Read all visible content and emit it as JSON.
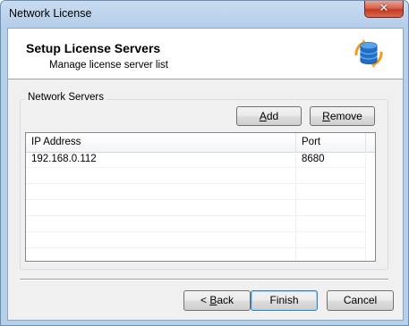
{
  "window": {
    "title": "Network License",
    "close_glyph": "✕"
  },
  "header": {
    "title": "Setup License Servers",
    "subtitle": "Manage license server list",
    "icon": "database-sync-icon"
  },
  "group": {
    "label": "Network Servers",
    "add_label": "Add",
    "add_accel": "A",
    "add_rest": "dd",
    "remove_label": "Remove",
    "remove_accel": "R",
    "remove_rest": "emove"
  },
  "table": {
    "columns": [
      "IP Address",
      "Port"
    ],
    "rows": [
      {
        "ip": "192.168.0.112",
        "port": "8680"
      }
    ]
  },
  "footer": {
    "back_prefix": "< ",
    "back_accel": "B",
    "back_rest": "ack",
    "finish_label": "Finish",
    "cancel_label": "Cancel"
  },
  "colors": {
    "titlebar": "#b9d1ea",
    "close_button": "#c7432c",
    "dialog_bg": "#f0f0f0"
  }
}
